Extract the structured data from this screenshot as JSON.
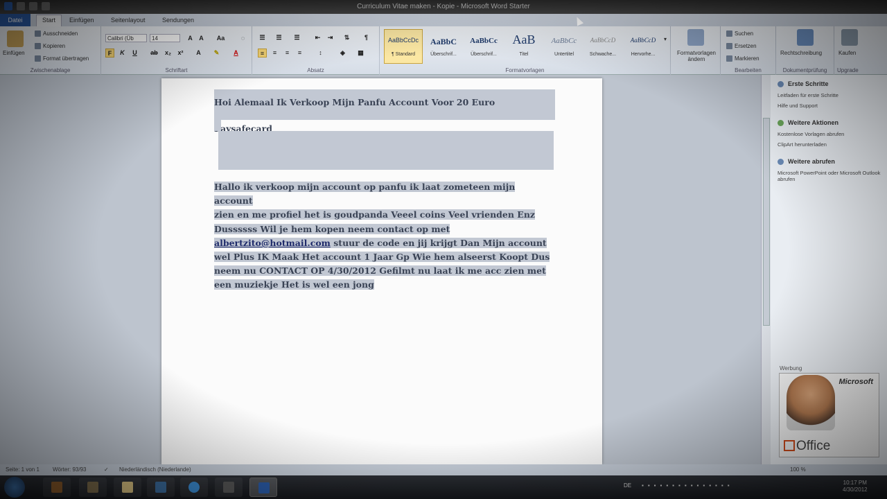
{
  "window": {
    "title": "Curriculum Vitae maken - Kopie - Microsoft Word Starter"
  },
  "tabs": {
    "file": "Datei",
    "items": [
      "Start",
      "Einfügen",
      "Seitenlayout",
      "Sendungen"
    ]
  },
  "ribbon": {
    "clipboard": {
      "paste": "Einfügen",
      "cut": "Ausschneiden",
      "copy": "Kopieren",
      "format_painter": "Format übertragen",
      "label": "Zwischenablage"
    },
    "font": {
      "font_name": "Calibri (Üb",
      "font_size": "14",
      "label": "Schriftart"
    },
    "paragraph": {
      "label": "Absatz"
    },
    "styles": {
      "label": "Formatvorlagen",
      "items": [
        {
          "sample": "AaBbCcDc",
          "name": "¶ Standard"
        },
        {
          "sample": "AaBbC",
          "name": "Überschrif..."
        },
        {
          "sample": "AaBbCc",
          "name": "Überschrif..."
        },
        {
          "sample": "AaB",
          "name": "Titel"
        },
        {
          "sample": "AaBbCc",
          "name": "Untertitel"
        },
        {
          "sample": "AaBbCcD",
          "name": "Schwache..."
        },
        {
          "sample": "AaBbCcD",
          "name": "Hervorhe..."
        }
      ],
      "change": "Formatvorlagen ändern"
    },
    "editing": {
      "find": "Suchen",
      "replace": "Ersetzen",
      "select": "Markieren",
      "label": "Bearbeiten"
    },
    "proofing": {
      "spelling": "Rechtschreibung",
      "label": "Dokumentprüfung"
    },
    "upgrade": {
      "buy": "Kaufen",
      "label": "Upgrade"
    }
  },
  "document": {
    "heading": "Hoi Alemaal Ik  Verkoop Mijn Panfu Account Voor 20 Euro Paysafecard",
    "body_lines": [
      "Hallo ik verkoop mijn account op panfu ik laat zometeen mijn account",
      "zien en me profiel het is goudpanda Veeel coins Veel vrienden Enz",
      "Dussssss Wil je hem kopen neem contact op met"
    ],
    "email": "albertzito@hotmail.com",
    "body_after_email": " stuur de code en jij krijgt Dan Mijn account",
    "body_lines2": [
      "wel Plus IK Maak Het account 1 Jaar Gp Wie hem alseerst Koopt Dus",
      "neem nu CONTACT OP 4/30/2012 Gefilmt nu laat ik me acc zien met",
      "een muziekje Het is wel een jong "
    ]
  },
  "taskpane": {
    "first_steps": "Erste Schritte",
    "guide": "Leitfaden für erste Schritte",
    "help": "Hilfe und Support",
    "more_actions": "Weitere Aktionen",
    "free_templates": "Kostenlose Vorlagen abrufen",
    "clipart": "ClipArt herunterladen",
    "more_get": "Weitere abrufen",
    "ppt_outlook": "Microsoft PowerPoint oder Microsoft Outlook abrufen",
    "ad_label": "Werbung",
    "ad_brand": "Microsoft",
    "ad_product": "Office"
  },
  "statusbar": {
    "page": "Seite: 1 von 1",
    "words": "Wörter: 93/93",
    "language": "Niederländisch (Niederlande)",
    "zoom": "100 %"
  },
  "taskbar": {
    "lang": "DE",
    "time": "10:17 PM",
    "date": "4/30/2012"
  }
}
